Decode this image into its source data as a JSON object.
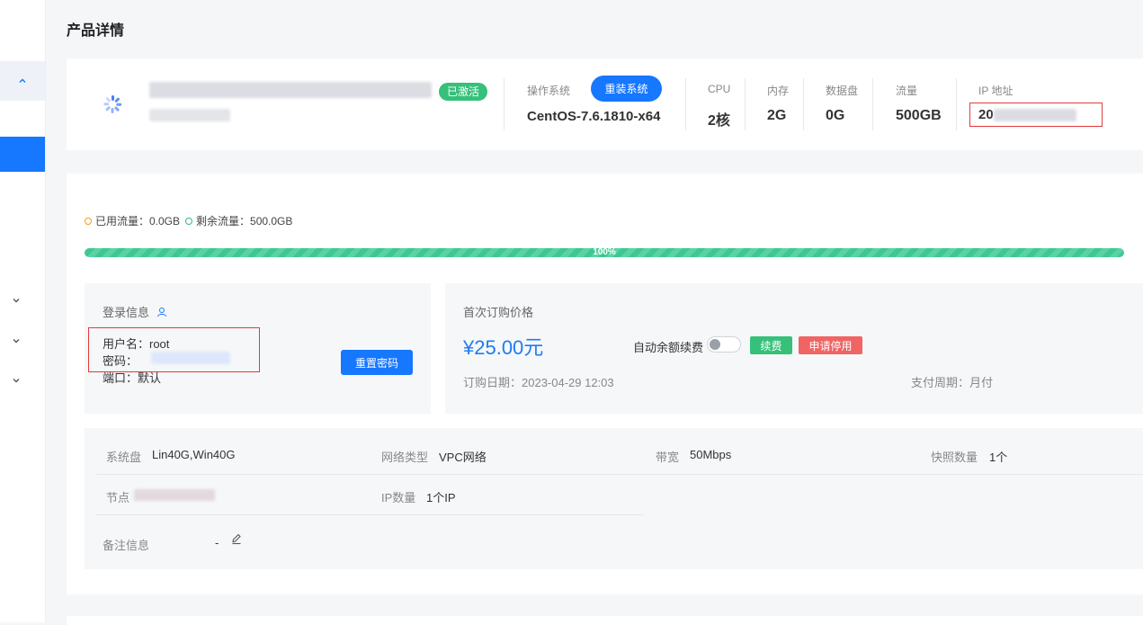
{
  "page": {
    "title": "产品详情"
  },
  "product": {
    "status_badge": "已激活",
    "os_label": "操作系统",
    "os_value": "CentOS-7.6.1810-x64",
    "reinstall_label": "重装系统",
    "specs": [
      {
        "label": "CPU",
        "value": "2核"
      },
      {
        "label": "内存",
        "value": "2G"
      },
      {
        "label": "数据盘",
        "value": "0G"
      },
      {
        "label": "流量",
        "value": "500GB"
      }
    ],
    "ip_label": "IP 地址",
    "ip_value_prefix": "20"
  },
  "traffic": {
    "used_label": "已用流量：0.0GB",
    "remaining_label": "剩余流量：500.0GB",
    "progress_text": "100%",
    "progress_fraction": 1.0,
    "colors": {
      "used": "#f0a21a",
      "remaining": "#36b59a",
      "bar": "#3fc792"
    }
  },
  "login": {
    "title": "登录信息",
    "username": "用户名：root",
    "password_label": "密码：",
    "port": "端口：默认",
    "reset_label": "重置密码"
  },
  "price": {
    "title": "首次订购价格",
    "amount": "¥25.00元",
    "auto_renew_label": "自动余额续费",
    "auto_renew_on": false,
    "renew_label": "续费",
    "stop_label": "申请停用",
    "order_date": "订购日期：2023-04-29 12:03",
    "pay_cycle": "支付周期：月付"
  },
  "attributes": {
    "system_disk_label": "系统盘",
    "system_disk_value": "Lin40G,Win40G",
    "network_label": "网络类型",
    "network_value": "VPC网络",
    "bandwidth_label": "带宽",
    "bandwidth_value": "50Mbps",
    "snapshot_label": "快照数量",
    "snapshot_value": "1个",
    "node_label": "节点",
    "ip_count_label": "IP数量",
    "ip_count_value": "1个IP",
    "remark_label": "备注信息",
    "remark_value": "-"
  },
  "colors": {
    "primary": "#1677ff",
    "success": "#36c07a",
    "danger": "#f06464",
    "highlight_box": "#e23b3b",
    "price": "#1e7cf2"
  }
}
